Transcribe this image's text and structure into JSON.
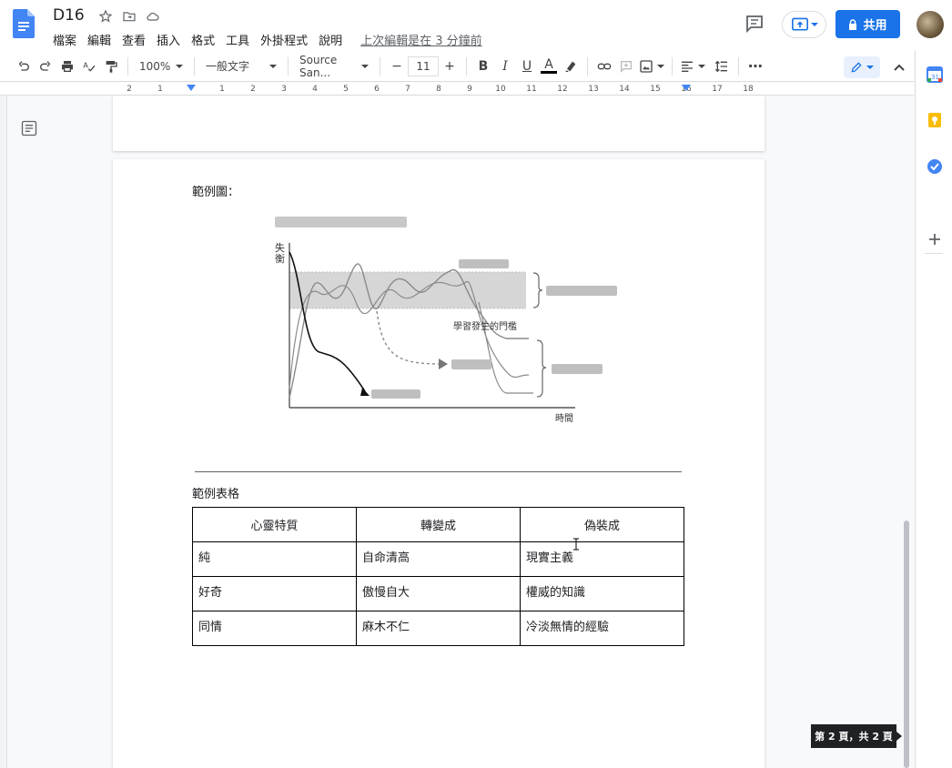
{
  "app": {
    "doc_title": "D16",
    "menu": [
      "檔案",
      "編輯",
      "查看",
      "插入",
      "格式",
      "工具",
      "外掛程式",
      "說明"
    ],
    "last_edit": "上次編輯是在 3 分鐘前",
    "share_label": "共用",
    "accent": "#1a73e8"
  },
  "toolbar": {
    "zoom": "100%",
    "style": "一般文字",
    "font": "Source San...",
    "font_size": "11",
    "minus": "−",
    "plus": "+",
    "bold": "B",
    "italic": "I",
    "underline": "U",
    "text_color": "A",
    "more": "⋯"
  },
  "ruler": {
    "numbers": [
      "2",
      "1",
      "1",
      "2",
      "3",
      "4",
      "5",
      "6",
      "7",
      "8",
      "9",
      "10",
      "11",
      "12",
      "13",
      "14",
      "15",
      "16",
      "17",
      "18"
    ]
  },
  "document": {
    "figure_label": "範例圖：",
    "figure": {
      "y_axis_label": "失\n衡",
      "x_axis_label": "時間",
      "threshold_label": "學習發生的門檻"
    },
    "table_label": "範例表格",
    "table": {
      "headers": [
        "心靈特質",
        "轉變成",
        "偽裝成"
      ],
      "rows": [
        [
          "純",
          "自命清高",
          "現實主義"
        ],
        [
          "好奇",
          "傲慢自大",
          "權威的知識"
        ],
        [
          "同情",
          "麻木不仁",
          "冷淡無情的經驗"
        ]
      ]
    }
  },
  "status": {
    "page_indicator": "第 2 頁，共 2 頁"
  }
}
